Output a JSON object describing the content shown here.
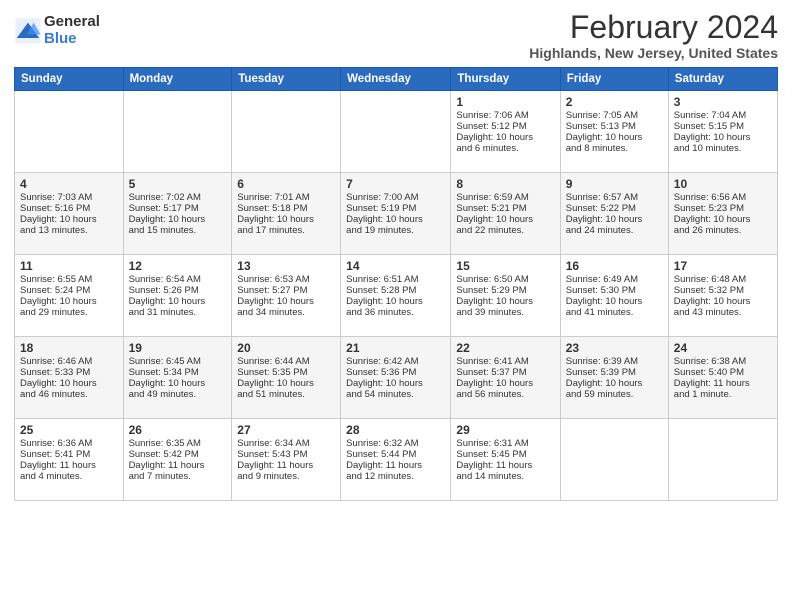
{
  "logo": {
    "general": "General",
    "blue": "Blue"
  },
  "title": "February 2024",
  "subtitle": "Highlands, New Jersey, United States",
  "days": [
    "Sunday",
    "Monday",
    "Tuesday",
    "Wednesday",
    "Thursday",
    "Friday",
    "Saturday"
  ],
  "weeks": [
    [
      {
        "num": "",
        "lines": []
      },
      {
        "num": "",
        "lines": []
      },
      {
        "num": "",
        "lines": []
      },
      {
        "num": "",
        "lines": []
      },
      {
        "num": "1",
        "lines": [
          "Sunrise: 7:06 AM",
          "Sunset: 5:12 PM",
          "Daylight: 10 hours",
          "and 6 minutes."
        ]
      },
      {
        "num": "2",
        "lines": [
          "Sunrise: 7:05 AM",
          "Sunset: 5:13 PM",
          "Daylight: 10 hours",
          "and 8 minutes."
        ]
      },
      {
        "num": "3",
        "lines": [
          "Sunrise: 7:04 AM",
          "Sunset: 5:15 PM",
          "Daylight: 10 hours",
          "and 10 minutes."
        ]
      }
    ],
    [
      {
        "num": "4",
        "lines": [
          "Sunrise: 7:03 AM",
          "Sunset: 5:16 PM",
          "Daylight: 10 hours",
          "and 13 minutes."
        ]
      },
      {
        "num": "5",
        "lines": [
          "Sunrise: 7:02 AM",
          "Sunset: 5:17 PM",
          "Daylight: 10 hours",
          "and 15 minutes."
        ]
      },
      {
        "num": "6",
        "lines": [
          "Sunrise: 7:01 AM",
          "Sunset: 5:18 PM",
          "Daylight: 10 hours",
          "and 17 minutes."
        ]
      },
      {
        "num": "7",
        "lines": [
          "Sunrise: 7:00 AM",
          "Sunset: 5:19 PM",
          "Daylight: 10 hours",
          "and 19 minutes."
        ]
      },
      {
        "num": "8",
        "lines": [
          "Sunrise: 6:59 AM",
          "Sunset: 5:21 PM",
          "Daylight: 10 hours",
          "and 22 minutes."
        ]
      },
      {
        "num": "9",
        "lines": [
          "Sunrise: 6:57 AM",
          "Sunset: 5:22 PM",
          "Daylight: 10 hours",
          "and 24 minutes."
        ]
      },
      {
        "num": "10",
        "lines": [
          "Sunrise: 6:56 AM",
          "Sunset: 5:23 PM",
          "Daylight: 10 hours",
          "and 26 minutes."
        ]
      }
    ],
    [
      {
        "num": "11",
        "lines": [
          "Sunrise: 6:55 AM",
          "Sunset: 5:24 PM",
          "Daylight: 10 hours",
          "and 29 minutes."
        ]
      },
      {
        "num": "12",
        "lines": [
          "Sunrise: 6:54 AM",
          "Sunset: 5:26 PM",
          "Daylight: 10 hours",
          "and 31 minutes."
        ]
      },
      {
        "num": "13",
        "lines": [
          "Sunrise: 6:53 AM",
          "Sunset: 5:27 PM",
          "Daylight: 10 hours",
          "and 34 minutes."
        ]
      },
      {
        "num": "14",
        "lines": [
          "Sunrise: 6:51 AM",
          "Sunset: 5:28 PM",
          "Daylight: 10 hours",
          "and 36 minutes."
        ]
      },
      {
        "num": "15",
        "lines": [
          "Sunrise: 6:50 AM",
          "Sunset: 5:29 PM",
          "Daylight: 10 hours",
          "and 39 minutes."
        ]
      },
      {
        "num": "16",
        "lines": [
          "Sunrise: 6:49 AM",
          "Sunset: 5:30 PM",
          "Daylight: 10 hours",
          "and 41 minutes."
        ]
      },
      {
        "num": "17",
        "lines": [
          "Sunrise: 6:48 AM",
          "Sunset: 5:32 PM",
          "Daylight: 10 hours",
          "and 43 minutes."
        ]
      }
    ],
    [
      {
        "num": "18",
        "lines": [
          "Sunrise: 6:46 AM",
          "Sunset: 5:33 PM",
          "Daylight: 10 hours",
          "and 46 minutes."
        ]
      },
      {
        "num": "19",
        "lines": [
          "Sunrise: 6:45 AM",
          "Sunset: 5:34 PM",
          "Daylight: 10 hours",
          "and 49 minutes."
        ]
      },
      {
        "num": "20",
        "lines": [
          "Sunrise: 6:44 AM",
          "Sunset: 5:35 PM",
          "Daylight: 10 hours",
          "and 51 minutes."
        ]
      },
      {
        "num": "21",
        "lines": [
          "Sunrise: 6:42 AM",
          "Sunset: 5:36 PM",
          "Daylight: 10 hours",
          "and 54 minutes."
        ]
      },
      {
        "num": "22",
        "lines": [
          "Sunrise: 6:41 AM",
          "Sunset: 5:37 PM",
          "Daylight: 10 hours",
          "and 56 minutes."
        ]
      },
      {
        "num": "23",
        "lines": [
          "Sunrise: 6:39 AM",
          "Sunset: 5:39 PM",
          "Daylight: 10 hours",
          "and 59 minutes."
        ]
      },
      {
        "num": "24",
        "lines": [
          "Sunrise: 6:38 AM",
          "Sunset: 5:40 PM",
          "Daylight: 11 hours",
          "and 1 minute."
        ]
      }
    ],
    [
      {
        "num": "25",
        "lines": [
          "Sunrise: 6:36 AM",
          "Sunset: 5:41 PM",
          "Daylight: 11 hours",
          "and 4 minutes."
        ]
      },
      {
        "num": "26",
        "lines": [
          "Sunrise: 6:35 AM",
          "Sunset: 5:42 PM",
          "Daylight: 11 hours",
          "and 7 minutes."
        ]
      },
      {
        "num": "27",
        "lines": [
          "Sunrise: 6:34 AM",
          "Sunset: 5:43 PM",
          "Daylight: 11 hours",
          "and 9 minutes."
        ]
      },
      {
        "num": "28",
        "lines": [
          "Sunrise: 6:32 AM",
          "Sunset: 5:44 PM",
          "Daylight: 11 hours",
          "and 12 minutes."
        ]
      },
      {
        "num": "29",
        "lines": [
          "Sunrise: 6:31 AM",
          "Sunset: 5:45 PM",
          "Daylight: 11 hours",
          "and 14 minutes."
        ]
      },
      {
        "num": "",
        "lines": []
      },
      {
        "num": "",
        "lines": []
      }
    ]
  ]
}
